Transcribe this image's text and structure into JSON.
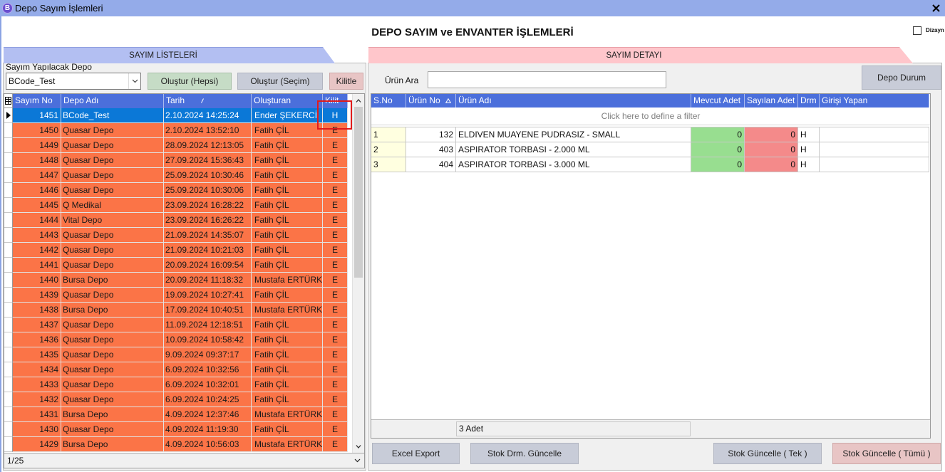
{
  "window": {
    "title": "Depo Sayım İşlemleri",
    "app_icon_letter": "B",
    "close_icon": "close-icon"
  },
  "page_title": "DEPO SAYIM ve ENVANTER İŞLEMLERİ",
  "design_toggle": {
    "label": "Dizayn",
    "checked": false
  },
  "left_panel": {
    "tab_label": "SAYIM LİSTELERİ",
    "depot_label": "Sayım Yapılacak Depo",
    "depot_value": "BCode_Test",
    "buttons": {
      "create_all": "Oluştur (Hepsi)",
      "create_selected": "Oluştur (Seçim)",
      "lock": "Kilitle"
    },
    "grid": {
      "columns": {
        "no": "Sayım No",
        "depo": "Depo Adı",
        "tarih": "Tarih",
        "olusturan": "Oluşturan",
        "kilit": "Kilit"
      },
      "rows": [
        {
          "no": "1451",
          "depo": "BCode_Test",
          "tarih": "2.10.2024 14:25:24",
          "olusturan": "Ender ŞEKERCİ",
          "kilit": "H",
          "selected": true
        },
        {
          "no": "1450",
          "depo": "Quasar Depo",
          "tarih": "2.10.2024 13:52:10",
          "olusturan": "Fatih ÇİL",
          "kilit": "E"
        },
        {
          "no": "1449",
          "depo": "Quasar Depo",
          "tarih": "28.09.2024 12:13:05",
          "olusturan": "Fatih ÇİL",
          "kilit": "E"
        },
        {
          "no": "1448",
          "depo": "Quasar Depo",
          "tarih": "27.09.2024 15:36:43",
          "olusturan": "Fatih ÇİL",
          "kilit": "E"
        },
        {
          "no": "1447",
          "depo": "Quasar Depo",
          "tarih": "25.09.2024 10:30:46",
          "olusturan": "Fatih ÇİL",
          "kilit": "E"
        },
        {
          "no": "1446",
          "depo": "Quasar Depo",
          "tarih": "25.09.2024 10:30:06",
          "olusturan": "Fatih ÇİL",
          "kilit": "E"
        },
        {
          "no": "1445",
          "depo": "Q Medikal",
          "tarih": "23.09.2024 16:28:22",
          "olusturan": "Fatih ÇİL",
          "kilit": "E"
        },
        {
          "no": "1444",
          "depo": "Vital Depo",
          "tarih": "23.09.2024 16:26:22",
          "olusturan": "Fatih ÇİL",
          "kilit": "E"
        },
        {
          "no": "1443",
          "depo": "Quasar Depo",
          "tarih": "21.09.2024 14:35:07",
          "olusturan": "Fatih ÇİL",
          "kilit": "E"
        },
        {
          "no": "1442",
          "depo": "Quasar Depo",
          "tarih": "21.09.2024 10:21:03",
          "olusturan": "Fatih ÇİL",
          "kilit": "E"
        },
        {
          "no": "1441",
          "depo": "Quasar Depo",
          "tarih": "20.09.2024 16:09:54",
          "olusturan": "Fatih ÇİL",
          "kilit": "E"
        },
        {
          "no": "1440",
          "depo": "Bursa Depo",
          "tarih": "20.09.2024 11:18:32",
          "olusturan": "Mustafa ERTÜRK",
          "kilit": "E"
        },
        {
          "no": "1439",
          "depo": "Quasar Depo",
          "tarih": "19.09.2024 10:27:41",
          "olusturan": "Fatih ÇİL",
          "kilit": "E"
        },
        {
          "no": "1438",
          "depo": "Bursa Depo",
          "tarih": "17.09.2024 10:40:51",
          "olusturan": "Mustafa ERTÜRK",
          "kilit": "E"
        },
        {
          "no": "1437",
          "depo": "Quasar Depo",
          "tarih": "11.09.2024 12:18:51",
          "olusturan": "Fatih ÇİL",
          "kilit": "E"
        },
        {
          "no": "1436",
          "depo": "Quasar Depo",
          "tarih": "10.09.2024 10:58:42",
          "olusturan": "Fatih ÇİL",
          "kilit": "E"
        },
        {
          "no": "1435",
          "depo": "Quasar Depo",
          "tarih": "9.09.2024 09:37:17",
          "olusturan": "Fatih ÇİL",
          "kilit": "E"
        },
        {
          "no": "1434",
          "depo": "Quasar Depo",
          "tarih": "6.09.2024 10:32:56",
          "olusturan": "Fatih ÇİL",
          "kilit": "E"
        },
        {
          "no": "1433",
          "depo": "Quasar Depo",
          "tarih": "6.09.2024 10:32:01",
          "olusturan": "Fatih ÇİL",
          "kilit": "E"
        },
        {
          "no": "1432",
          "depo": "Quasar Depo",
          "tarih": "6.09.2024 10:24:25",
          "olusturan": "Fatih ÇİL",
          "kilit": "E"
        },
        {
          "no": "1431",
          "depo": "Bursa Depo",
          "tarih": "4.09.2024 12:37:46",
          "olusturan": "Mustafa ERTÜRK",
          "kilit": "E"
        },
        {
          "no": "1430",
          "depo": "Quasar Depo",
          "tarih": "4.09.2024 11:19:30",
          "olusturan": "Fatih ÇİL",
          "kilit": "E"
        },
        {
          "no": "1429",
          "depo": "Bursa Depo",
          "tarih": "4.09.2024 10:56:03",
          "olusturan": "Mustafa ERTÜRK",
          "kilit": "E"
        }
      ],
      "pager": "1/25"
    }
  },
  "right_panel": {
    "tab_label": "SAYIM DETAYI",
    "search_label": "Ürün Ara",
    "depot_status_button": "Depo Durum",
    "grid": {
      "columns": {
        "sno": "S.No",
        "urun_no": "Ürün No",
        "urun_adi": "Ürün Adı",
        "mevcut": "Mevcut Adet",
        "sayilan": "Sayılan Adet",
        "drm": "Drm",
        "girisi": "Girişi Yapan"
      },
      "filter_prompt": "Click here to define a filter",
      "rows": [
        {
          "sno": "1",
          "urun_no": "132",
          "urun_adi": "ELDIVEN MUAYENE PUDRASIZ - SMALL",
          "mevcut": "0",
          "sayilan": "0",
          "drm": "H"
        },
        {
          "sno": "2",
          "urun_no": "403",
          "urun_adi": "ASPIRATOR TORBASI - 2.000 ML",
          "mevcut": "0",
          "sayilan": "0",
          "drm": "H"
        },
        {
          "sno": "3",
          "urun_no": "404",
          "urun_adi": "ASPIRATOR TORBASI - 3.000 ML",
          "mevcut": "0",
          "sayilan": "0",
          "drm": "H"
        }
      ],
      "footer_count": "3 Adet"
    },
    "buttons": {
      "excel_export": "Excel Export",
      "update_stock_status": "Stok Drm. Güncelle",
      "update_stock_one": "Stok Güncelle ( Tek )",
      "update_stock_all": "Stok Güncelle ( Tümü )"
    }
  },
  "colors": {
    "title_bar": "#94abe9",
    "left_tab": "#b3bff2",
    "right_tab": "#ffc6cb",
    "grid_header": "#4b6fdb",
    "row_locked": "#fb7447",
    "row_selected": "#0b78d7",
    "sno_cell": "#ffffe0",
    "mevcut_cell": "#98de90",
    "sayilan_cell": "#f48a8a",
    "highlight_box": "#e01b1b"
  }
}
